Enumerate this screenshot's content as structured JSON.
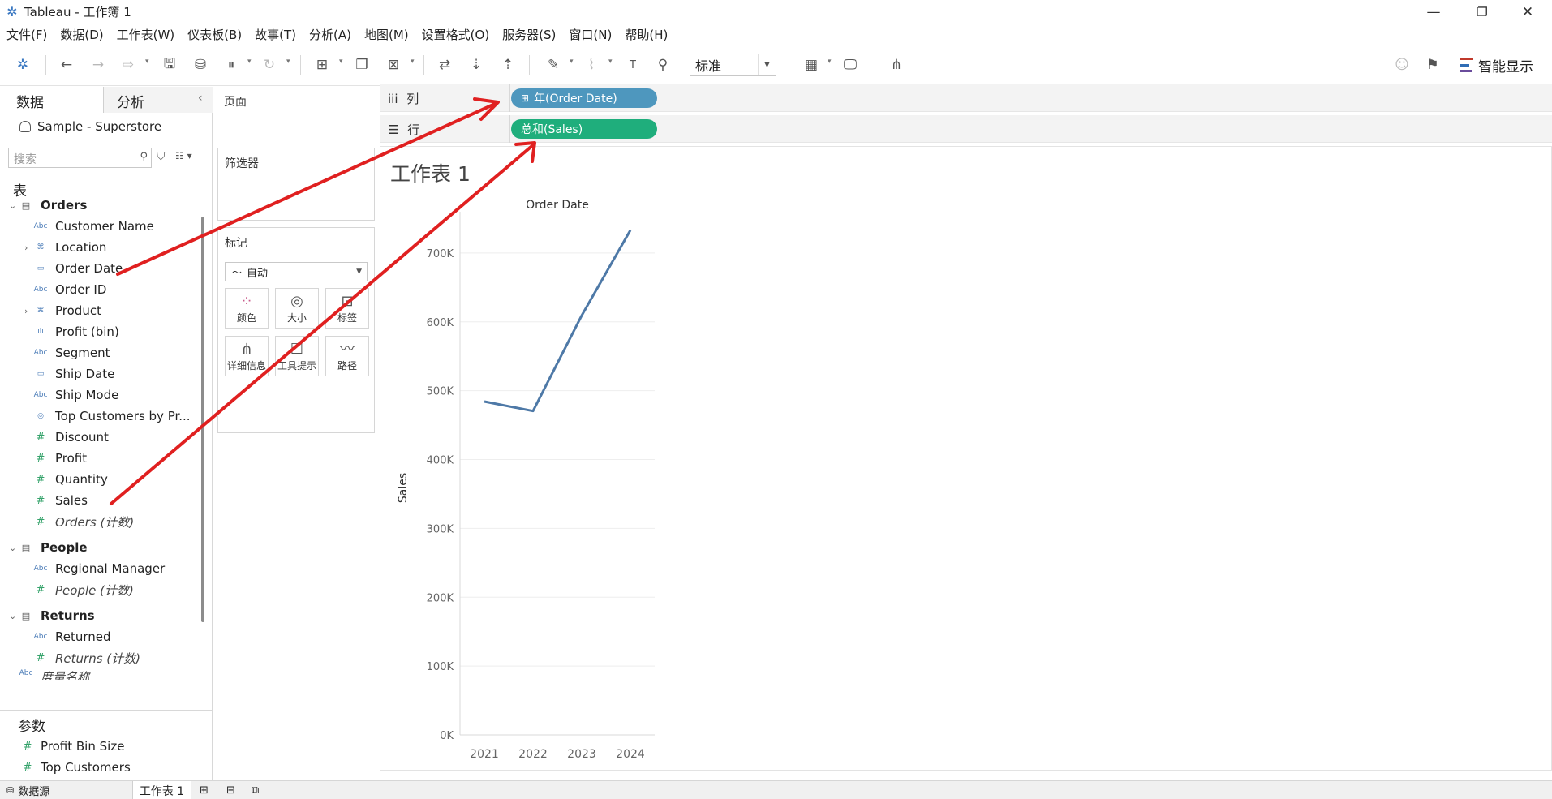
{
  "window": {
    "title": "Tableau - 工作簿 1",
    "controls": [
      "—",
      "❐",
      "✕"
    ]
  },
  "menubar": [
    "文件(F)",
    "数据(D)",
    "工作表(W)",
    "仪表板(B)",
    "故事(T)",
    "分析(A)",
    "地图(M)",
    "设置格式(O)",
    "服务器(S)",
    "窗口(N)",
    "帮助(H)"
  ],
  "toolbar": {
    "fit_value": "标准",
    "show_me_label": "智能显示"
  },
  "data_pane": {
    "tabs": [
      "数据",
      "分析"
    ],
    "datasource": "Sample - Superstore",
    "search_placeholder": "搜索",
    "tables_header": "表",
    "tables": [
      {
        "name": "Orders",
        "fields": [
          {
            "label": "Customer Name",
            "type": "Abc"
          },
          {
            "label": "Location",
            "type": "hier",
            "expandable": true
          },
          {
            "label": "Order Date",
            "type": "date"
          },
          {
            "label": "Order ID",
            "type": "Abc"
          },
          {
            "label": "Product",
            "type": "hier",
            "expandable": true
          },
          {
            "label": "Profit (bin)",
            "type": "bin"
          },
          {
            "label": "Segment",
            "type": "Abc"
          },
          {
            "label": "Ship Date",
            "type": "date"
          },
          {
            "label": "Ship Mode",
            "type": "Abc"
          },
          {
            "label": "Top Customers by Pr...",
            "type": "set"
          },
          {
            "label": "Discount",
            "type": "#"
          },
          {
            "label": "Profit",
            "type": "#"
          },
          {
            "label": "Quantity",
            "type": "#"
          },
          {
            "label": "Sales",
            "type": "#"
          },
          {
            "label": "Orders (计数)",
            "type": "#",
            "italic": true
          }
        ]
      },
      {
        "name": "People",
        "fields": [
          {
            "label": "Regional Manager",
            "type": "Abc"
          },
          {
            "label": "People (计数)",
            "type": "#",
            "italic": true
          }
        ]
      },
      {
        "name": "Returns",
        "fields": [
          {
            "label": "Returned",
            "type": "Abc"
          },
          {
            "label": "Returns (计数)",
            "type": "#",
            "italic": true
          }
        ]
      }
    ],
    "measure_names_partial": "度量名称",
    "params_header": "参数",
    "params": [
      "Profit Bin Size",
      "Top Customers"
    ]
  },
  "cards": {
    "pages": "页面",
    "filters": "筛选器",
    "marks": "标记",
    "marks_type": "自动",
    "mark_buttons": [
      "颜色",
      "大小",
      "标签",
      "详细信息",
      "工具提示",
      "路径"
    ]
  },
  "shelves": {
    "columns_label": "列",
    "rows_label": "行",
    "columns_pill": "年(Order Date)",
    "rows_pill": "总和(Sales)",
    "columns_icon": "iii",
    "rows_icon": "☰",
    "columns_pill_prefix": "⊞"
  },
  "sheet_title": "工作表 1",
  "chart_data": {
    "type": "line",
    "title": "Order Date",
    "xlabel": "Order Date",
    "ylabel": "Sales",
    "categories": [
      "2021",
      "2022",
      "2023",
      "2024"
    ],
    "series": [
      {
        "values": [
          484247,
          470533,
          609206,
          733215
        ]
      }
    ],
    "ylim": [
      0,
      760000
    ],
    "yticks": [
      0,
      100000,
      200000,
      300000,
      400000,
      500000,
      600000,
      700000
    ],
    "ytick_labels": [
      "0K",
      "100K",
      "200K",
      "300K",
      "400K",
      "500K",
      "600K",
      "700K"
    ],
    "line_color": "#4e79a7",
    "grid": true
  },
  "statusbar": {
    "datasource_tab": "数据源",
    "sheet_tab": "工作表 1"
  },
  "colors": {
    "pill_dimension": "#4e97be",
    "pill_measure": "#1fae7c",
    "annotation_arrow": "#e02020"
  }
}
